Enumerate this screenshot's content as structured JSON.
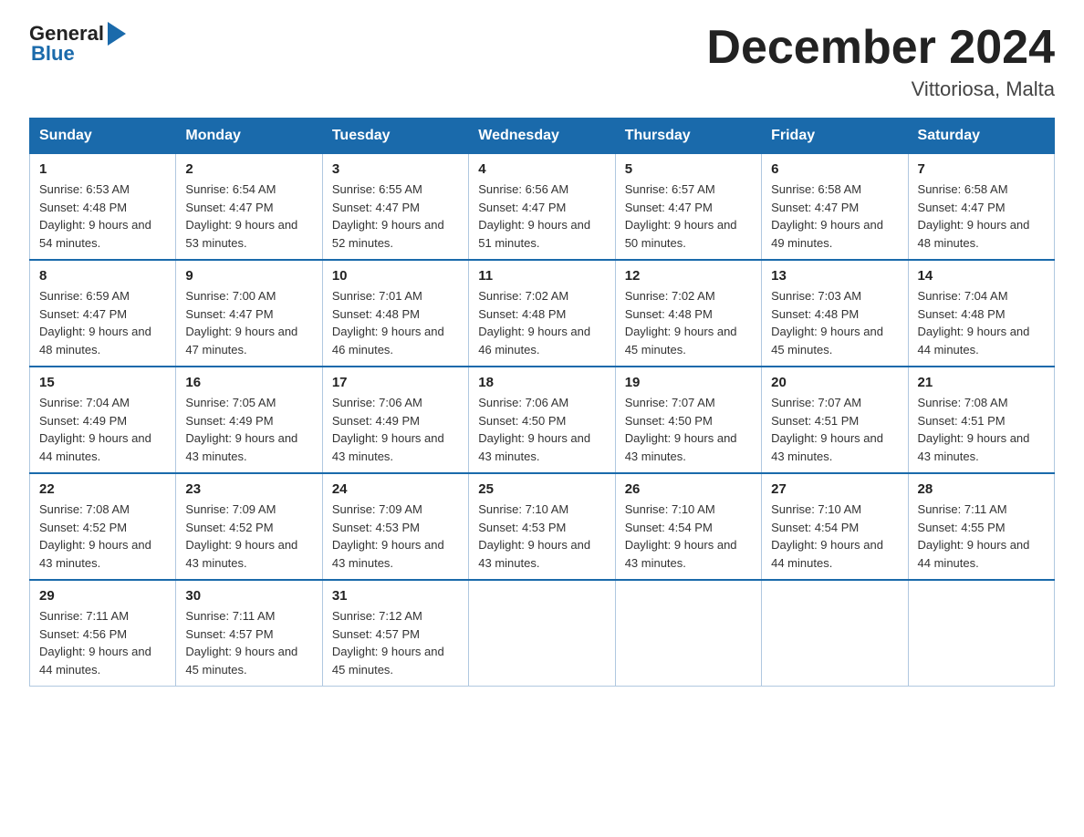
{
  "logo": {
    "general": "General",
    "blue": "Blue"
  },
  "title": "December 2024",
  "subtitle": "Vittoriosa, Malta",
  "weekdays": [
    "Sunday",
    "Monday",
    "Tuesday",
    "Wednesday",
    "Thursday",
    "Friday",
    "Saturday"
  ],
  "weeks": [
    [
      {
        "day": "1",
        "sunrise": "6:53 AM",
        "sunset": "4:48 PM",
        "daylight": "9 hours and 54 minutes."
      },
      {
        "day": "2",
        "sunrise": "6:54 AM",
        "sunset": "4:47 PM",
        "daylight": "9 hours and 53 minutes."
      },
      {
        "day": "3",
        "sunrise": "6:55 AM",
        "sunset": "4:47 PM",
        "daylight": "9 hours and 52 minutes."
      },
      {
        "day": "4",
        "sunrise": "6:56 AM",
        "sunset": "4:47 PM",
        "daylight": "9 hours and 51 minutes."
      },
      {
        "day": "5",
        "sunrise": "6:57 AM",
        "sunset": "4:47 PM",
        "daylight": "9 hours and 50 minutes."
      },
      {
        "day": "6",
        "sunrise": "6:58 AM",
        "sunset": "4:47 PM",
        "daylight": "9 hours and 49 minutes."
      },
      {
        "day": "7",
        "sunrise": "6:58 AM",
        "sunset": "4:47 PM",
        "daylight": "9 hours and 48 minutes."
      }
    ],
    [
      {
        "day": "8",
        "sunrise": "6:59 AM",
        "sunset": "4:47 PM",
        "daylight": "9 hours and 48 minutes."
      },
      {
        "day": "9",
        "sunrise": "7:00 AM",
        "sunset": "4:47 PM",
        "daylight": "9 hours and 47 minutes."
      },
      {
        "day": "10",
        "sunrise": "7:01 AM",
        "sunset": "4:48 PM",
        "daylight": "9 hours and 46 minutes."
      },
      {
        "day": "11",
        "sunrise": "7:02 AM",
        "sunset": "4:48 PM",
        "daylight": "9 hours and 46 minutes."
      },
      {
        "day": "12",
        "sunrise": "7:02 AM",
        "sunset": "4:48 PM",
        "daylight": "9 hours and 45 minutes."
      },
      {
        "day": "13",
        "sunrise": "7:03 AM",
        "sunset": "4:48 PM",
        "daylight": "9 hours and 45 minutes."
      },
      {
        "day": "14",
        "sunrise": "7:04 AM",
        "sunset": "4:48 PM",
        "daylight": "9 hours and 44 minutes."
      }
    ],
    [
      {
        "day": "15",
        "sunrise": "7:04 AM",
        "sunset": "4:49 PM",
        "daylight": "9 hours and 44 minutes."
      },
      {
        "day": "16",
        "sunrise": "7:05 AM",
        "sunset": "4:49 PM",
        "daylight": "9 hours and 43 minutes."
      },
      {
        "day": "17",
        "sunrise": "7:06 AM",
        "sunset": "4:49 PM",
        "daylight": "9 hours and 43 minutes."
      },
      {
        "day": "18",
        "sunrise": "7:06 AM",
        "sunset": "4:50 PM",
        "daylight": "9 hours and 43 minutes."
      },
      {
        "day": "19",
        "sunrise": "7:07 AM",
        "sunset": "4:50 PM",
        "daylight": "9 hours and 43 minutes."
      },
      {
        "day": "20",
        "sunrise": "7:07 AM",
        "sunset": "4:51 PM",
        "daylight": "9 hours and 43 minutes."
      },
      {
        "day": "21",
        "sunrise": "7:08 AM",
        "sunset": "4:51 PM",
        "daylight": "9 hours and 43 minutes."
      }
    ],
    [
      {
        "day": "22",
        "sunrise": "7:08 AM",
        "sunset": "4:52 PM",
        "daylight": "9 hours and 43 minutes."
      },
      {
        "day": "23",
        "sunrise": "7:09 AM",
        "sunset": "4:52 PM",
        "daylight": "9 hours and 43 minutes."
      },
      {
        "day": "24",
        "sunrise": "7:09 AM",
        "sunset": "4:53 PM",
        "daylight": "9 hours and 43 minutes."
      },
      {
        "day": "25",
        "sunrise": "7:10 AM",
        "sunset": "4:53 PM",
        "daylight": "9 hours and 43 minutes."
      },
      {
        "day": "26",
        "sunrise": "7:10 AM",
        "sunset": "4:54 PM",
        "daylight": "9 hours and 43 minutes."
      },
      {
        "day": "27",
        "sunrise": "7:10 AM",
        "sunset": "4:54 PM",
        "daylight": "9 hours and 44 minutes."
      },
      {
        "day": "28",
        "sunrise": "7:11 AM",
        "sunset": "4:55 PM",
        "daylight": "9 hours and 44 minutes."
      }
    ],
    [
      {
        "day": "29",
        "sunrise": "7:11 AM",
        "sunset": "4:56 PM",
        "daylight": "9 hours and 44 minutes."
      },
      {
        "day": "30",
        "sunrise": "7:11 AM",
        "sunset": "4:57 PM",
        "daylight": "9 hours and 45 minutes."
      },
      {
        "day": "31",
        "sunrise": "7:12 AM",
        "sunset": "4:57 PM",
        "daylight": "9 hours and 45 minutes."
      },
      null,
      null,
      null,
      null
    ]
  ]
}
